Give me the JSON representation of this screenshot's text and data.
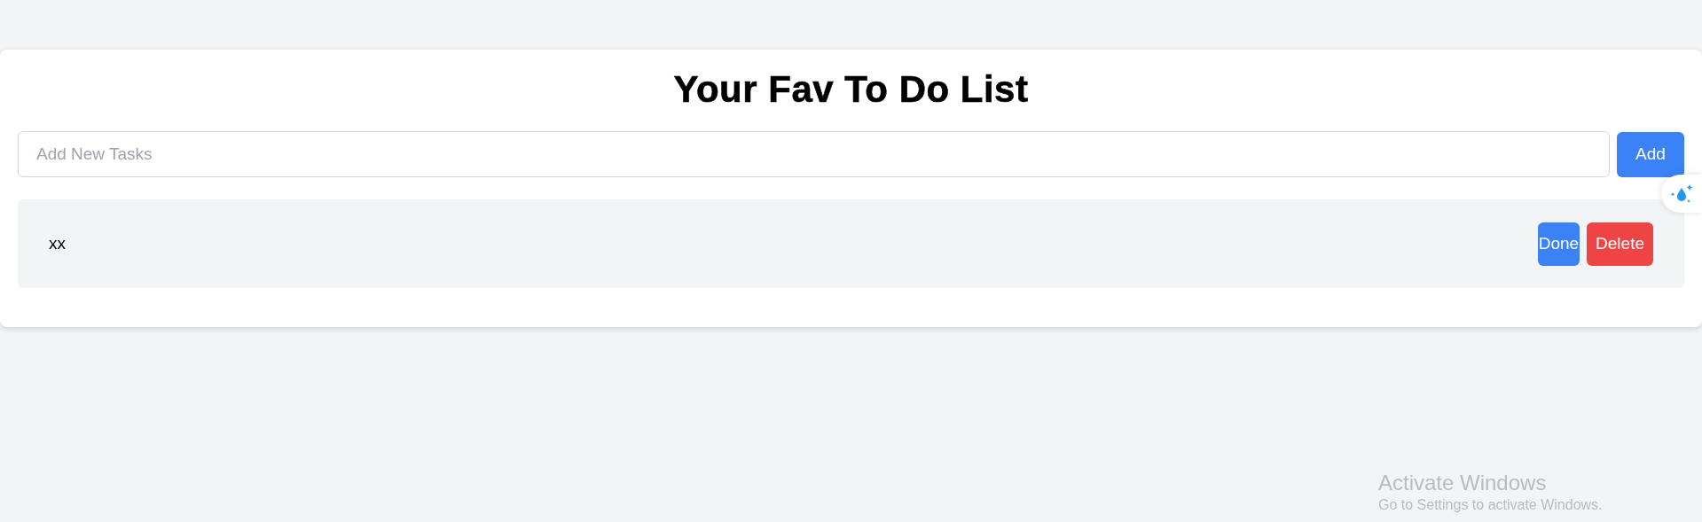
{
  "title": "Your Fav To Do List",
  "new_task": {
    "placeholder": "Add New Tasks",
    "button": "Add"
  },
  "tasks": [
    {
      "text": "xx",
      "buttons": [
        {
          "label": "Done",
          "kind": "done"
        },
        {
          "label": "Delete",
          "kind": "delete"
        }
      ]
    }
  ],
  "os_notice": {
    "title": "Activate Windows",
    "text": "Go to Settings to activate Windows."
  }
}
